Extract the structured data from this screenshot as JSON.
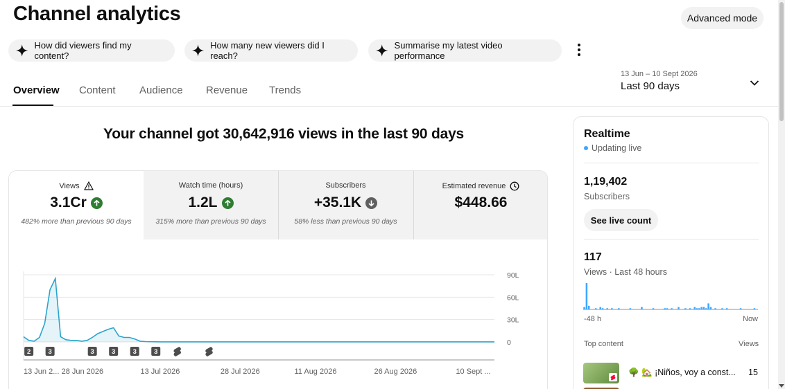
{
  "header": {
    "title": "Channel analytics",
    "advanced_mode": "Advanced mode"
  },
  "suggestions": [
    {
      "label": "How did viewers find my content?"
    },
    {
      "label": "How many new viewers did I reach?"
    },
    {
      "label": "Summarise my latest video performance"
    }
  ],
  "tabs": [
    {
      "label": "Overview",
      "active": true
    },
    {
      "label": "Content"
    },
    {
      "label": "Audience"
    },
    {
      "label": "Revenue"
    },
    {
      "label": "Trends"
    }
  ],
  "date_range": {
    "range": "13 Jun – 10 Sept 2026",
    "preset": "Last 90 days"
  },
  "headline": "Your channel got 30,642,916 views in the last 90 days",
  "metrics": [
    {
      "label": "Views",
      "value": "3.1Cr",
      "trend": "up",
      "note": "482% more than previous 90 days",
      "icon": "warning-icon"
    },
    {
      "label": "Watch time (hours)",
      "value": "1.2L",
      "trend": "up",
      "note": "315% more than previous 90 days"
    },
    {
      "label": "Subscribers",
      "value": "+35.1K",
      "trend": "down",
      "note": "58% less than previous 90 days"
    },
    {
      "label": "Estimated revenue",
      "value": "$448.66",
      "icon": "clock-icon"
    }
  ],
  "colors": {
    "accent": "#3ea6ff",
    "line": "#2ba3cc",
    "up": "#2e7d32",
    "down": "#606060"
  },
  "chart_data": {
    "type": "area",
    "title": "",
    "xlabel": "",
    "ylabel": "",
    "x_tick_labels": [
      "13 Jun 2...",
      "28 Jun 2026",
      "13 Jul 2026",
      "28 Jul 2026",
      "11 Aug 2026",
      "26 Aug 2026",
      "10 Sept ..."
    ],
    "y_tick_labels": [
      "90L",
      "60L",
      "30L",
      "0"
    ],
    "y_ticks": [
      90,
      60,
      30,
      0
    ],
    "ylim": [
      0,
      90
    ],
    "unit": "L (lakh) views",
    "series": [
      {
        "values": [
          7,
          2,
          1,
          6,
          25,
          70,
          85,
          7,
          3,
          2,
          2,
          1,
          2,
          6,
          11,
          14,
          17,
          19,
          8,
          6,
          6,
          4,
          1,
          0.5,
          0.3,
          0.2,
          0.1,
          0.1,
          0.1,
          0.1,
          0.1,
          0.1,
          0.1,
          0.1,
          0.1,
          0.1,
          0.1,
          0.1,
          0.1,
          0.1,
          0.1,
          0.1,
          0.1,
          0.1,
          0.1,
          0.1,
          0.1,
          0.1,
          0.1,
          0.1,
          0.1,
          0.1,
          0.1,
          0.1,
          0.1,
          0.1,
          0.1,
          0.1,
          0.1,
          0.1,
          0.1,
          0.1,
          0.1,
          0.1,
          0.1,
          0.1,
          0.1,
          0.1,
          0.1,
          0.1,
          0.1,
          0.1,
          0.1,
          0.1,
          0.1,
          0.1,
          0.1,
          0.1,
          0.1,
          0.1,
          0.1,
          0.1,
          0.1,
          0.1,
          0.1,
          0.1,
          0.1,
          0.1,
          0.1,
          0.1
        ]
      }
    ],
    "upload_markers": [
      {
        "day": 1,
        "label": "2"
      },
      {
        "day": 5,
        "label": "3"
      },
      {
        "day": 13,
        "label": "3"
      },
      {
        "day": 17,
        "label": "3"
      },
      {
        "day": 21,
        "label": "3"
      },
      {
        "day": 25,
        "label": "3"
      },
      {
        "day": 29,
        "label": ""
      },
      {
        "day": 35,
        "label": ""
      }
    ],
    "grid": true,
    "legend": "none"
  },
  "realtime": {
    "title": "Realtime",
    "status": "Updating live",
    "subscribers_value": "1,19,402",
    "subscribers_label": "Subscribers",
    "live_count_button": "See live count",
    "views_value": "117",
    "views_label": "Views · Last 48 hours",
    "axis_start": "-48 h",
    "axis_end": "Now",
    "top_content_label": "Top content",
    "views_col_label": "Views",
    "bar_values": [
      2,
      22,
      3,
      0,
      0,
      1,
      0,
      2,
      1,
      0,
      1,
      0,
      1,
      0,
      0,
      1,
      0,
      0,
      0,
      0,
      1,
      0,
      0,
      0,
      0,
      2,
      0,
      0,
      0,
      0,
      1,
      0,
      0,
      0,
      0,
      1,
      1,
      0,
      1,
      0,
      0,
      2,
      0,
      0,
      1,
      0,
      1,
      0,
      2,
      1,
      1,
      2,
      2,
      1,
      5,
      2,
      0,
      1,
      0,
      0,
      1,
      0,
      1,
      0,
      0,
      0,
      0,
      0,
      1,
      0,
      0,
      0,
      0,
      0,
      1,
      0
    ],
    "top_content": [
      {
        "title": "🌳 🏡 ¡Niños, voy a const...",
        "views": "15"
      }
    ]
  }
}
